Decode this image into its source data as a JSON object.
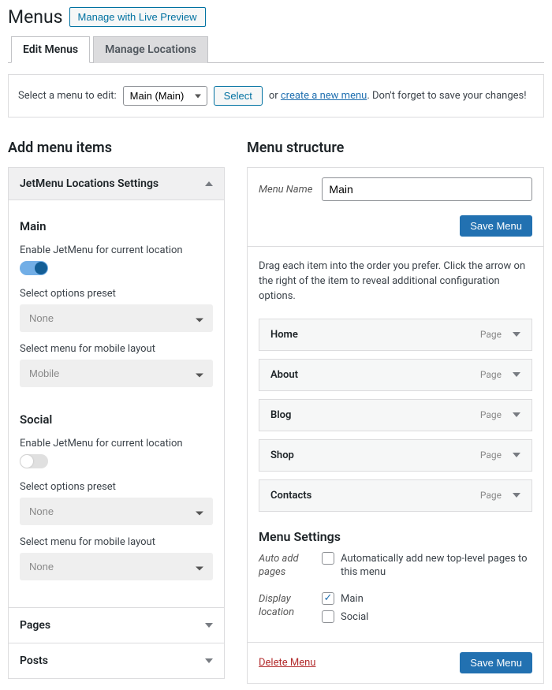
{
  "header": {
    "title": "Menus",
    "live_preview": "Manage with Live Preview"
  },
  "tabs": {
    "edit": "Edit Menus",
    "locations": "Manage Locations"
  },
  "select_bar": {
    "label": "Select a menu to edit:",
    "selected": "Main (Main)",
    "select_btn": "Select",
    "or": "or",
    "create_link": "create a new menu",
    "tail": ". Don't forget to save your changes!"
  },
  "left": {
    "heading": "Add menu items",
    "jetmenu": {
      "title": "JetMenu Locations Settings",
      "loc1": {
        "name": "Main",
        "enable_label": "Enable JetMenu for current location",
        "preset_label": "Select options preset",
        "preset_value": "None",
        "mobile_label": "Select menu for mobile layout",
        "mobile_value": "Mobile"
      },
      "loc2": {
        "name": "Social",
        "enable_label": "Enable JetMenu for current location",
        "preset_label": "Select options preset",
        "preset_value": "None",
        "mobile_label": "Select menu for mobile layout",
        "mobile_value": "None"
      }
    },
    "pages": "Pages",
    "posts": "Posts"
  },
  "right": {
    "heading": "Menu structure",
    "menu_name_label": "Menu Name",
    "menu_name_value": "Main",
    "save_btn": "Save Menu",
    "instructions": "Drag each item into the order you prefer. Click the arrow on the right of the item to reveal additional configuration options.",
    "items": [
      {
        "name": "Home",
        "type": "Page"
      },
      {
        "name": "About",
        "type": "Page"
      },
      {
        "name": "Blog",
        "type": "Page"
      },
      {
        "name": "Shop",
        "type": "Page"
      },
      {
        "name": "Contacts",
        "type": "Page"
      }
    ],
    "settings": {
      "title": "Menu Settings",
      "auto_label": "Auto add pages",
      "auto_desc": "Automatically add new top-level pages to this menu",
      "display_label": "Display location",
      "loc_main": "Main",
      "loc_social": "Social"
    },
    "delete": "Delete Menu"
  }
}
